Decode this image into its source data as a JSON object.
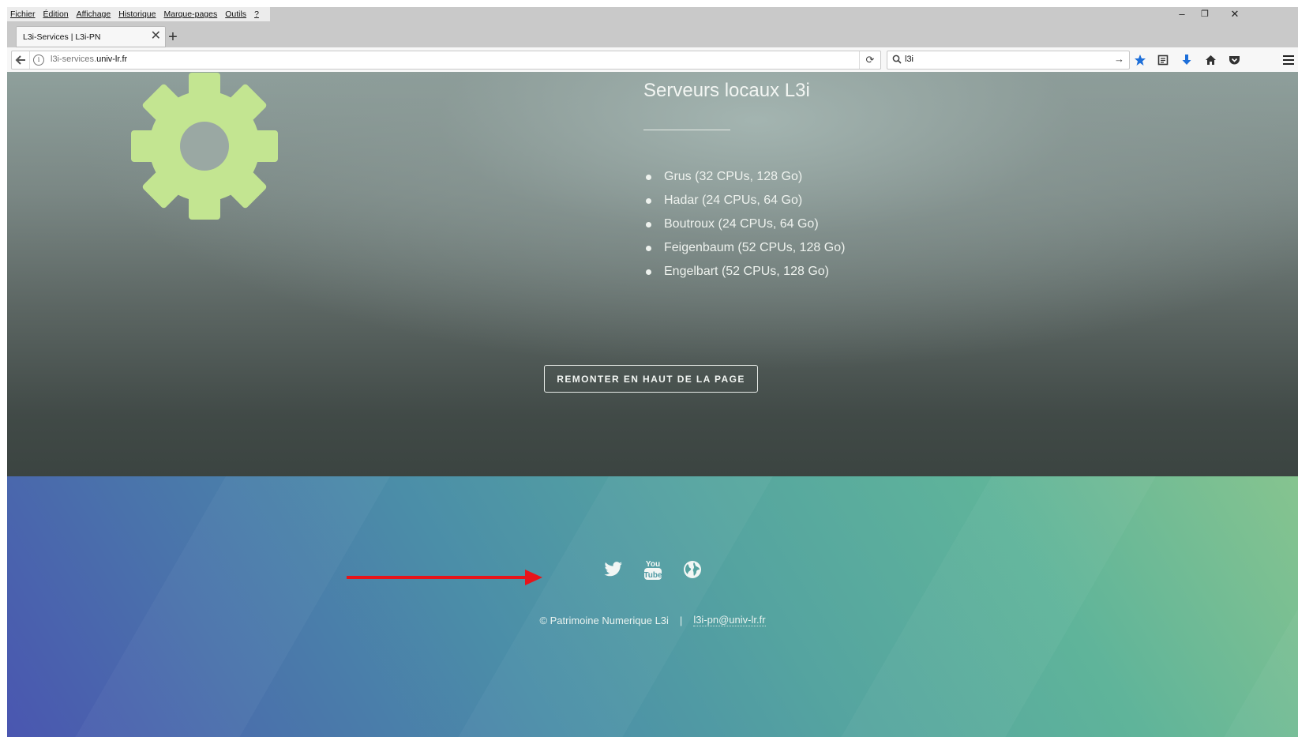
{
  "menubar": {
    "items": [
      "Fichier",
      "Édition",
      "Affichage",
      "Historique",
      "Marque-pages",
      "Outils",
      "?"
    ]
  },
  "window_controls": {
    "minimize": "–",
    "restore": "❐",
    "close": "✕"
  },
  "tabs": [
    {
      "title": "L3i-Services | L3i-PN",
      "close": "✕"
    }
  ],
  "new_tab": "+",
  "urlbar": {
    "host_prefix": "l3i-services.",
    "host_domain": "univ-lr.fr",
    "reload": "⟳"
  },
  "searchbar": {
    "value": "l3i",
    "go": "→"
  },
  "toolbar_icons": [
    "bookmark-star-icon",
    "reading-list-icon",
    "downloads-icon",
    "home-icon",
    "pocket-icon",
    "menu-icon"
  ],
  "hero": {
    "title": "Serveurs locaux L3i",
    "servers": [
      "Grus (32 CPUs, 128 Go)",
      "Hadar (24 CPUs, 64 Go)",
      "Boutroux (24 CPUs, 64 Go)",
      "Feigenbaum (52 CPUs, 128 Go)",
      "Engelbart (52 CPUs, 128 Go)"
    ],
    "scroll_top_label": "REMONTER EN HAUT DE LA PAGE",
    "gear_color": "#c3e591"
  },
  "footer": {
    "social": [
      "twitter-icon",
      "youtube-icon",
      "globe-icon"
    ],
    "copyright": "© Patrimoine Numerique L3i",
    "separator": "|",
    "email": "l3i-pn@univ-lr.fr"
  },
  "colors": {
    "annotation_arrow": "#e8141a",
    "bookmark_star": "#1e6fd9",
    "downloads": "#1e6fd9"
  }
}
